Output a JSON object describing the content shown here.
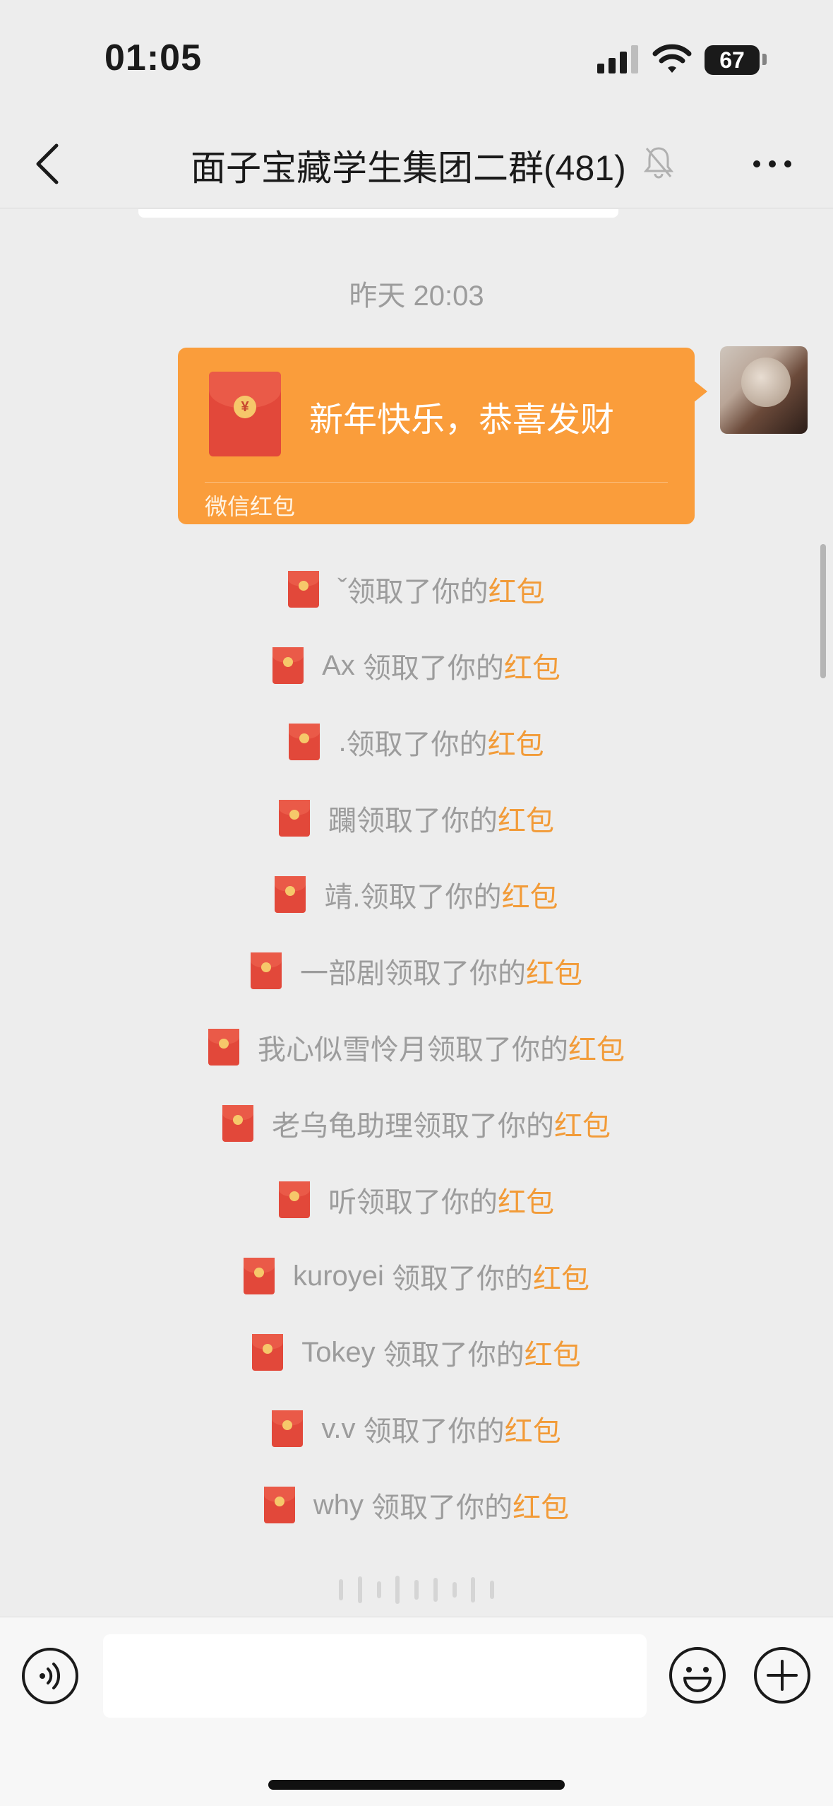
{
  "status_bar": {
    "time": "01:05",
    "battery": "67",
    "icons": [
      "signal-icon",
      "wifi-icon",
      "battery-icon"
    ]
  },
  "nav": {
    "back_icon": "chevron-left-icon",
    "title": "面子宝藏学生集团二群(481)",
    "mute_icon": "bell-muted-icon",
    "more_icon": "more-dots-icon"
  },
  "chat": {
    "timestamp": "昨天 20:03",
    "red_envelope": {
      "greeting": "新年快乐，恭喜发财",
      "label": "微信红包",
      "coin_symbol": "¥",
      "color": "#fa9d3b"
    },
    "claims": [
      {
        "name": "ˇ",
        "text": "领取了你的",
        "link": "红包"
      },
      {
        "name": "Ax ",
        "text": "领取了你的",
        "link": "红包"
      },
      {
        "name": ".",
        "text": "领取了你的",
        "link": "红包"
      },
      {
        "name": "躝",
        "text": "领取了你的",
        "link": "红包"
      },
      {
        "name": "靖.",
        "text": "领取了你的",
        "link": "红包"
      },
      {
        "name": "一部剧",
        "text": "领取了你的",
        "link": "红包"
      },
      {
        "name": "我心似雪怜月",
        "text": "领取了你的",
        "link": "红包"
      },
      {
        "name": "老乌龟助理",
        "text": "领取了你的",
        "link": "红包"
      },
      {
        "name": "听",
        "text": "领取了你的",
        "link": "红包"
      },
      {
        "name": "kuroyei ",
        "text": "领取了你的",
        "link": "红包"
      },
      {
        "name": "Tokey ",
        "text": "领取了你的",
        "link": "红包"
      },
      {
        "name": "v.v ",
        "text": "领取了你的",
        "link": "红包"
      },
      {
        "name": "why ",
        "text": "领取了你的",
        "link": "红包"
      }
    ],
    "link_color": "#f29b38"
  },
  "input_bar": {
    "voice_icon": "voice-input-icon",
    "message_value": "",
    "emoji_icon": "emoji-icon",
    "plus_icon": "plus-icon"
  }
}
